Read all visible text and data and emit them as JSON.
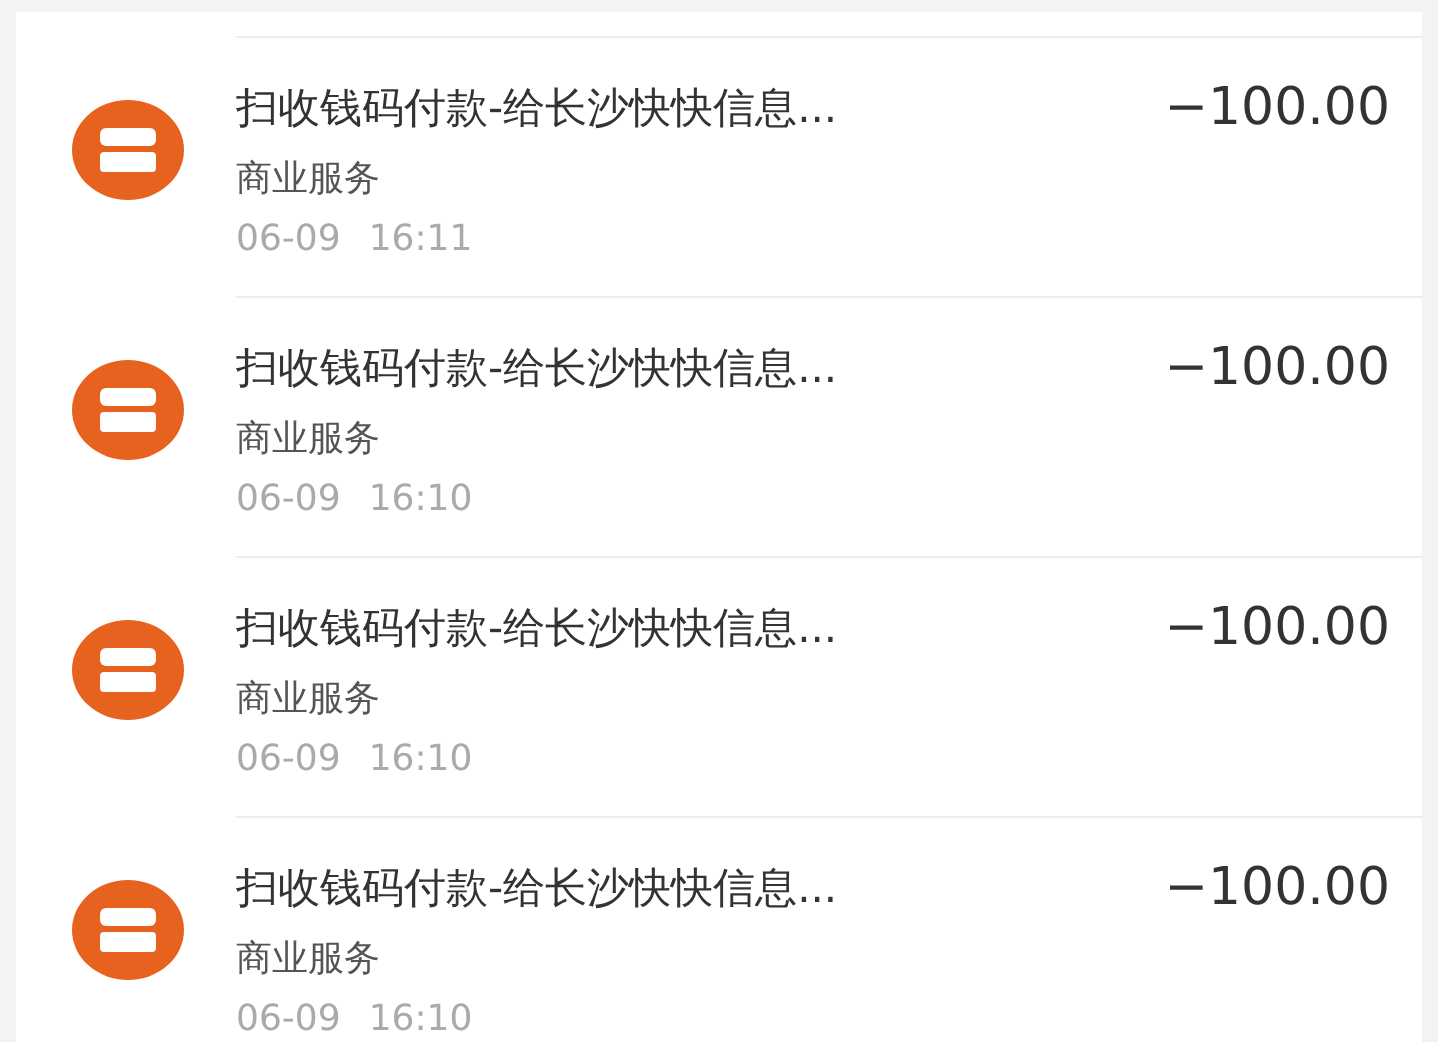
{
  "transactions": [
    {
      "title": "扫收钱码付款-给长沙快快信息...",
      "category": "商业服务",
      "date": "06-09",
      "time": "16:11",
      "amount": "−100.00"
    },
    {
      "title": "扫收钱码付款-给长沙快快信息...",
      "category": "商业服务",
      "date": "06-09",
      "time": "16:10",
      "amount": "−100.00"
    },
    {
      "title": "扫收钱码付款-给长沙快快信息...",
      "category": "商业服务",
      "date": "06-09",
      "time": "16:10",
      "amount": "−100.00"
    },
    {
      "title": "扫收钱码付款-给长沙快快信息...",
      "category": "商业服务",
      "date": "06-09",
      "time": "16:10",
      "amount": "−100.00"
    }
  ]
}
